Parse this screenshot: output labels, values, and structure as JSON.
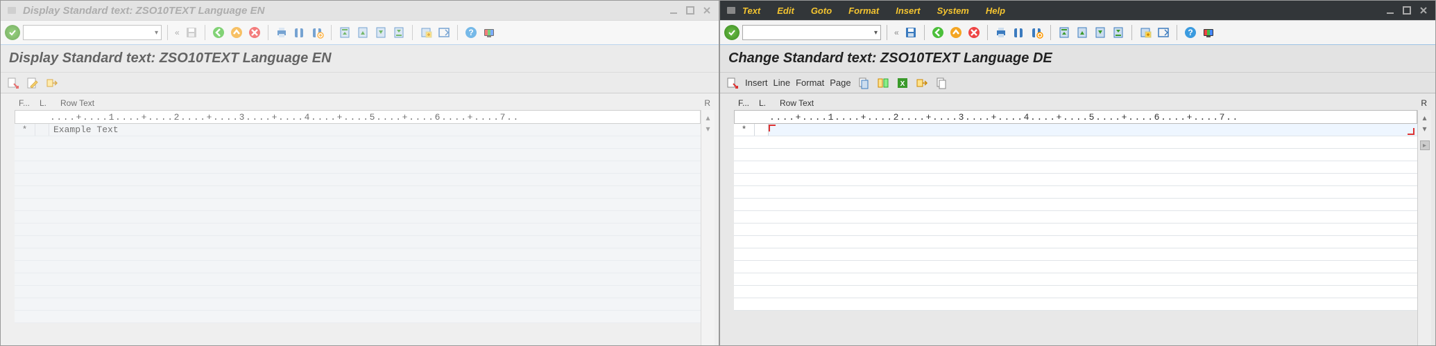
{
  "left": {
    "title": "Display Standard text: ZSO10TEXT Language EN",
    "subtitle": "Display Standard text: ZSO10TEXT Language EN",
    "header": {
      "f": "F...",
      "l": "L.",
      "row": "Row Text",
      "r": "R"
    },
    "ruler": "....+....1....+....2....+....3....+....4....+....5....+....6....+....7..",
    "lines": [
      {
        "mark": "*",
        "text": "Example Text"
      }
    ]
  },
  "right": {
    "title": "",
    "menus": [
      "Text",
      "Edit",
      "Goto",
      "Format",
      "Insert",
      "System",
      "Help"
    ],
    "subtitle": "Change Standard text: ZSO10TEXT Language DE",
    "apptoolbar": [
      "Insert",
      "Line",
      "Format",
      "Page"
    ],
    "header": {
      "f": "F...",
      "l": "L.",
      "row": "Row Text",
      "r": "R"
    },
    "ruler": "....+....1....+....2....+....3....+....4....+....5....+....6....+....7..",
    "lines": [
      {
        "mark": "*",
        "text": ""
      }
    ]
  },
  "icons": {
    "save": "save",
    "back_green": "back",
    "up_orange": "up",
    "cancel_red": "cancel",
    "print": "print",
    "find": "find",
    "findnext": "findnext",
    "first": "first",
    "prev": "prev",
    "next": "next",
    "last": "last",
    "newwin": "newwin",
    "layout": "layout",
    "help": "help",
    "screen": "screen"
  }
}
